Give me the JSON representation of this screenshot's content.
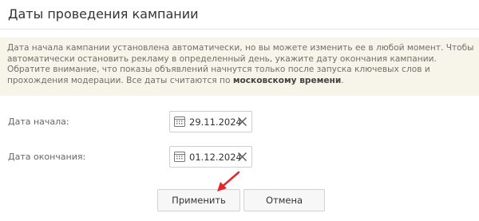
{
  "header": {
    "title": "Даты проведения кампании"
  },
  "notice": {
    "text": "Дата начала кампании установлена автоматически, но вы можете изменить ее в любой момент. Чтобы автоматически остановить рекламу в определенный день, укажите дату окончания кампании. Обратите внимание, что показы объявлений начнутся только после запуска ключевых слов и прохождения модерации. Все даты считаются по ",
    "bold": "московскому времени",
    "end": "."
  },
  "start_date": {
    "label": "Дата начала:",
    "value": "29.11.2024",
    "icon": "calendar-icon",
    "clear_icon": "close-icon"
  },
  "end_date": {
    "label": "Дата окончания:",
    "value": "01.12.2024",
    "icon": "calendar-icon",
    "clear_icon": "close-icon"
  },
  "buttons": {
    "apply": "Применить",
    "cancel": "Отмена"
  },
  "colors": {
    "notice_bg": "#f7f5e9",
    "arrow": "#e3262b"
  }
}
